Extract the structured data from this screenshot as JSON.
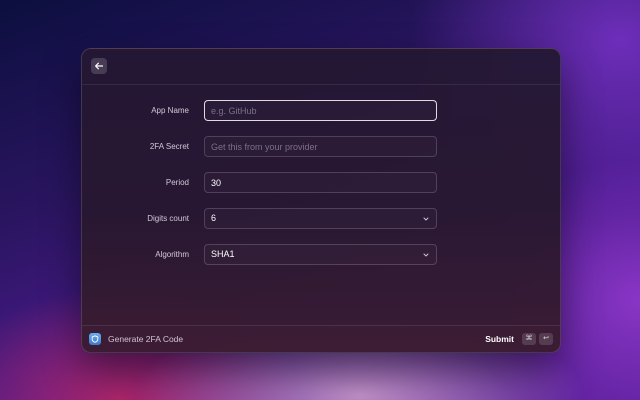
{
  "window": {
    "back_icon": "arrow-left-icon"
  },
  "form": {
    "app_name": {
      "label": "App Name",
      "value": "",
      "placeholder": "e.g. GitHub"
    },
    "secret": {
      "label": "2FA Secret",
      "value": "",
      "placeholder": "Get this from your provider"
    },
    "period": {
      "label": "Period",
      "value": "30"
    },
    "digits": {
      "label": "Digits count",
      "value": "6"
    },
    "algorithm": {
      "label": "Algorithm",
      "value": "SHA1"
    }
  },
  "footer": {
    "icon": "shield-app-icon",
    "title": "Generate 2FA Code",
    "submit_label": "Submit",
    "shortcut_cmd": "⌘",
    "shortcut_enter": "↩"
  },
  "colors": {
    "focus_border": "#d9d4e2",
    "app_icon": "#4f8fdc"
  }
}
